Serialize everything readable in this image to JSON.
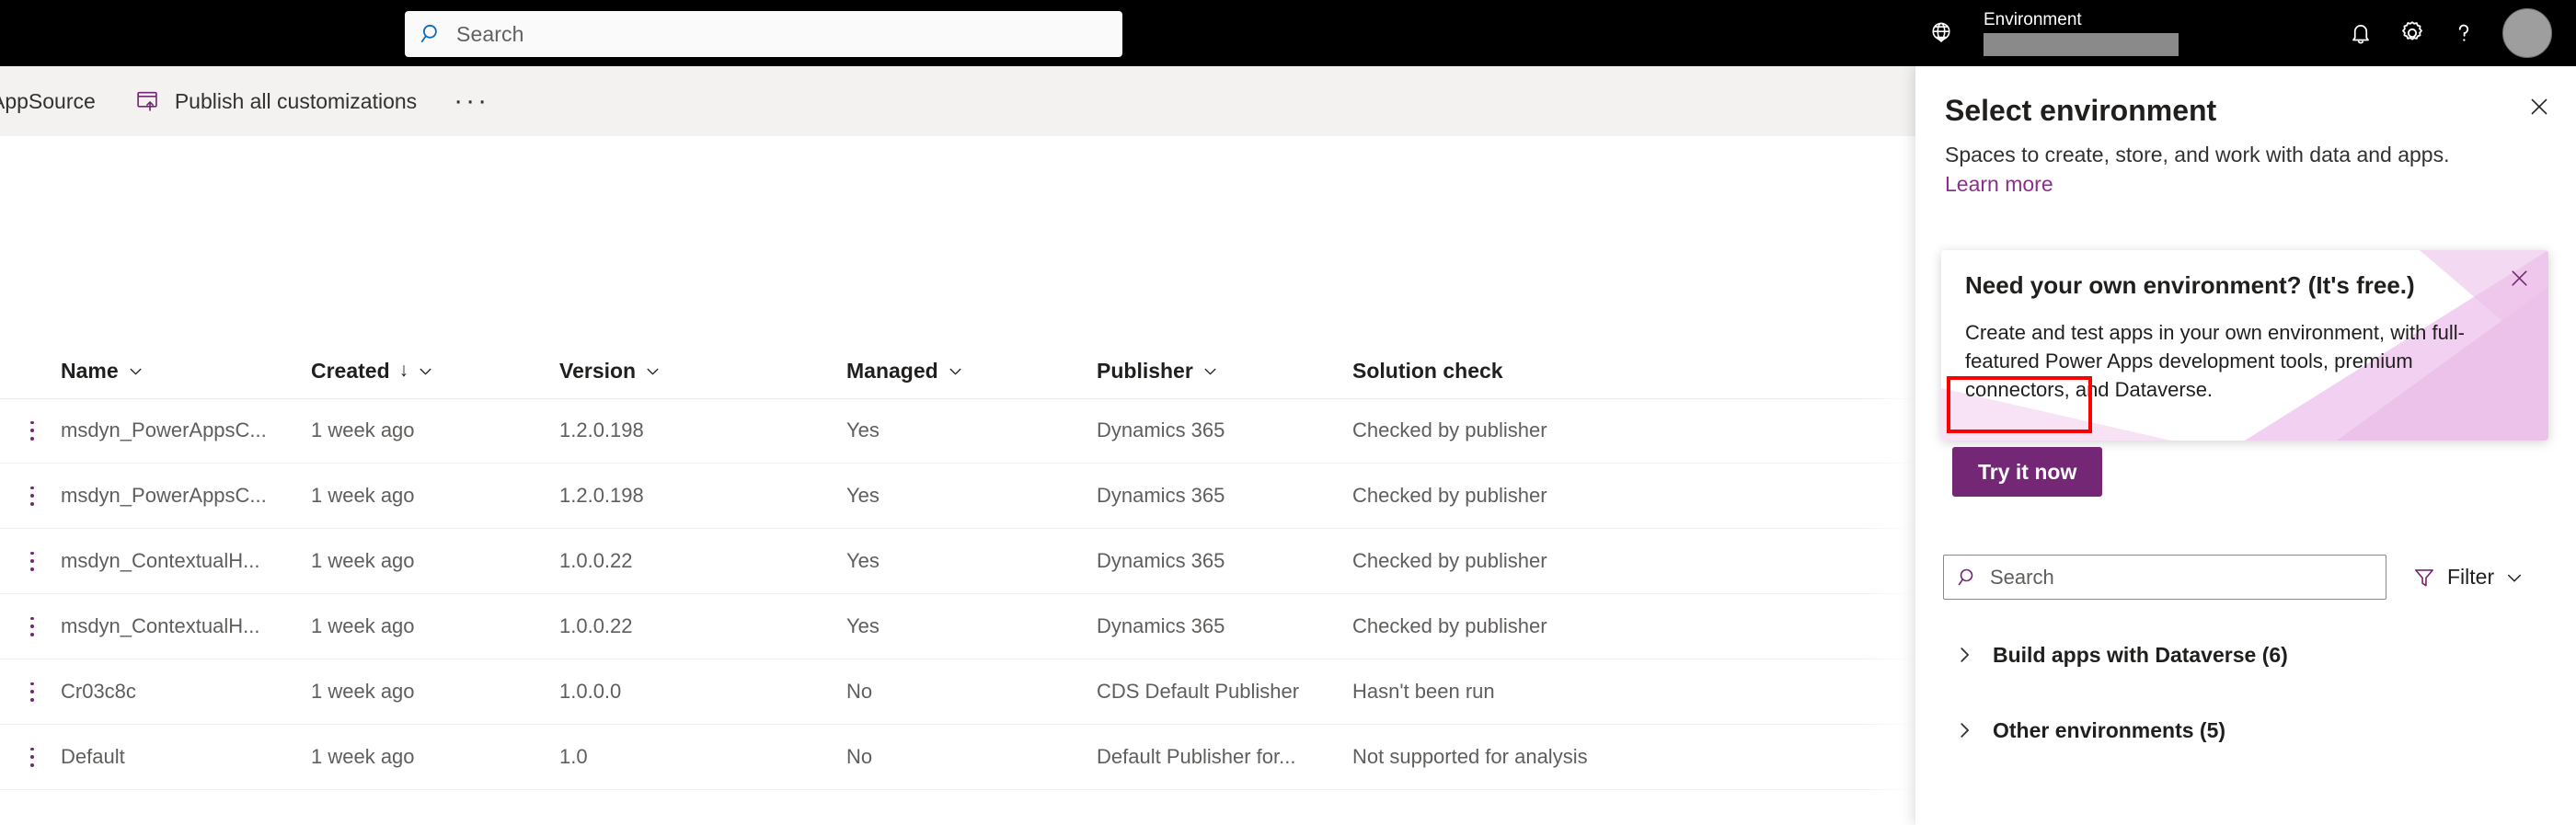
{
  "topbar": {
    "search_placeholder": "Search",
    "search_icon": "search-icon",
    "globe_icon": "globe-icon",
    "environment_label": "Environment",
    "environment_value": "",
    "bell_icon": "notifications-bell-icon",
    "gear_icon": "settings-gear-icon",
    "help_icon": "help-question-icon",
    "avatar_icon": "user-avatar"
  },
  "commandbar": {
    "appsource_label": "AppSource",
    "publish_label": "Publish all customizations",
    "publish_icon": "publish-upload-icon",
    "overflow_label": "···"
  },
  "table": {
    "columns": [
      {
        "label": "Name",
        "sorted": false,
        "chevron": true
      },
      {
        "label": "Created",
        "sorted": true,
        "sort_dir": "↓",
        "chevron": true
      },
      {
        "label": "Version",
        "sorted": false,
        "chevron": true
      },
      {
        "label": "Managed",
        "sorted": false,
        "chevron": true
      },
      {
        "label": "Publisher",
        "sorted": false,
        "chevron": true
      },
      {
        "label": "Solution check",
        "sorted": false,
        "chevron": false
      }
    ],
    "rows": [
      {
        "name": "msdyn_PowerAppsC...",
        "created": "1 week ago",
        "version": "1.2.0.198",
        "managed": "Yes",
        "publisher": "Dynamics 365",
        "solution_check": "Checked by publisher"
      },
      {
        "name": "msdyn_PowerAppsC...",
        "created": "1 week ago",
        "version": "1.2.0.198",
        "managed": "Yes",
        "publisher": "Dynamics 365",
        "solution_check": "Checked by publisher"
      },
      {
        "name": "msdyn_ContextualH...",
        "created": "1 week ago",
        "version": "1.0.0.22",
        "managed": "Yes",
        "publisher": "Dynamics 365",
        "solution_check": "Checked by publisher"
      },
      {
        "name": "msdyn_ContextualH...",
        "created": "1 week ago",
        "version": "1.0.0.22",
        "managed": "Yes",
        "publisher": "Dynamics 365",
        "solution_check": "Checked by publisher"
      },
      {
        "name": "Cr03c8c",
        "created": "1 week ago",
        "version": "1.0.0.0",
        "managed": "No",
        "publisher": "CDS Default Publisher",
        "solution_check": "Hasn't been run"
      },
      {
        "name": "Default",
        "created": "1 week ago",
        "version": "1.0",
        "managed": "No",
        "publisher": "Default Publisher for...",
        "solution_check": "Not supported for analysis"
      }
    ]
  },
  "panel": {
    "title": "Select environment",
    "subtitle": "Spaces to create, store, and work with data and apps.",
    "learn_more": "Learn more",
    "close_icon": "close-icon",
    "callout": {
      "title": "Need your own environment? (It's free.)",
      "body": "Create and test apps in your own environment, with full-featured Power Apps development tools, premium connectors, and Dataverse.",
      "button_label": "Try it now",
      "close_icon": "close-icon"
    },
    "search_placeholder": "Search",
    "search_icon": "search-icon",
    "filter_label": "Filter",
    "filter_icon": "filter-funnel-icon",
    "groups": [
      {
        "label": "Build apps with Dataverse (6)",
        "expanded": false
      },
      {
        "label": "Other environments (5)",
        "expanded": false
      }
    ]
  },
  "colors": {
    "brand_purple": "#742774",
    "link_purple": "#8a2f8a",
    "topbar_black": "#000000",
    "command_bar_gray": "#f3f2f1",
    "annotation_red": "#ff0000"
  }
}
